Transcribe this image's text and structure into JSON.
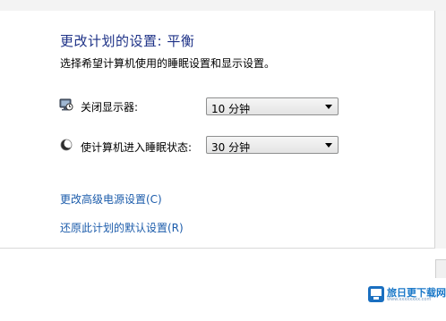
{
  "header": {
    "title": "更改计划的设置: 平衡",
    "subtitle": "选择希望计算机使用的睡眠设置和显示设置。"
  },
  "settings": [
    {
      "label": "关闭显示器:",
      "icon": "monitor-clock-icon",
      "value": "10 分钟"
    },
    {
      "label": "使计算机进入睡眠状态:",
      "icon": "moon-icon",
      "value": "30 分钟"
    }
  ],
  "links": {
    "advanced": "更改高级电源设置(C)",
    "restore": "还原此计划的默认设置(R)"
  },
  "watermark": {
    "text": "旅日更下载网",
    "sub": "www.xxxxxxxx.com",
    "logo": "watermark-logo-icon"
  },
  "colors": {
    "title": "#1e3287",
    "link": "#1c5cab"
  }
}
